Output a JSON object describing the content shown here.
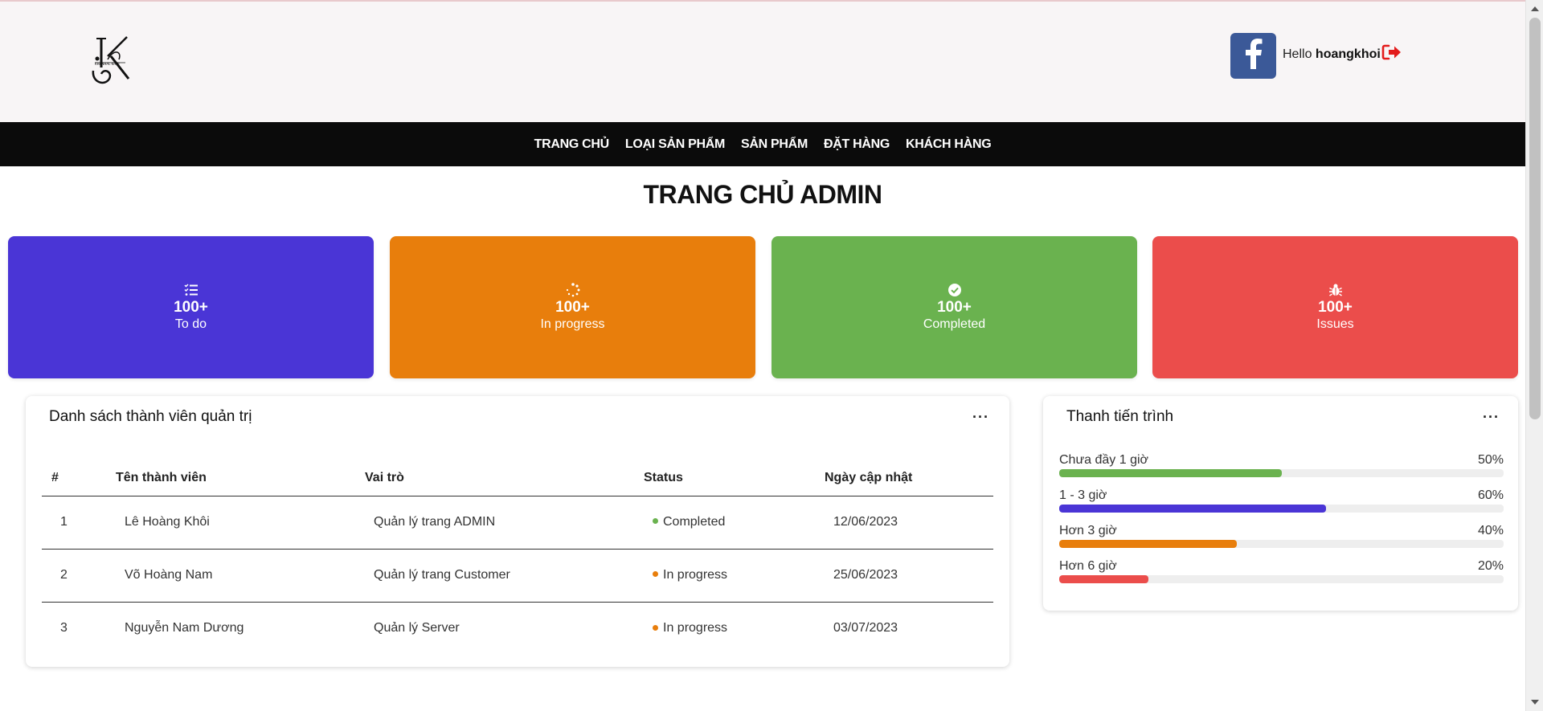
{
  "header": {
    "logo_icon": "kv-monogram-logo",
    "facebook_icon": "facebook-icon",
    "hello_prefix": "Hello",
    "username": "hoangkhoi",
    "logout_icon": "sign-out-icon",
    "logout_color": "#e31b1b"
  },
  "nav": {
    "items": [
      "TRANG CHỦ",
      "LOẠI SẢN PHẨM",
      "SẢN PHẨM",
      "ĐẶT HÀNG",
      "KHÁCH HÀNG"
    ]
  },
  "page_title": "TRANG CHỦ ADMIN",
  "stats": [
    {
      "icon": "task-list-icon",
      "value": "100+",
      "label": "To do",
      "color": "#4a35d6"
    },
    {
      "icon": "spinner-icon",
      "value": "100+",
      "label": "In progress",
      "color": "#e87e0c"
    },
    {
      "icon": "check-circle-icon",
      "value": "100+",
      "label": "Completed",
      "color": "#6ab24f"
    },
    {
      "icon": "bug-icon",
      "value": "100+",
      "label": "Issues",
      "color": "#eb4d4b"
    }
  ],
  "members_panel": {
    "title": "Danh sách thành viên quản trị",
    "menu_icon": "more-horizontal-icon",
    "columns": [
      "#",
      "Tên thành viên",
      "Vai trò",
      "Status",
      "Ngày cập nhật"
    ],
    "rows": [
      {
        "no": "1",
        "name": "Lê Hoàng Khôi",
        "role": "Quản lý trang ADMIN",
        "status": "Completed",
        "status_color": "#6ab24f",
        "date": "12/06/2023"
      },
      {
        "no": "2",
        "name": "Võ Hoàng Nam",
        "role": "Quản lý trang Customer",
        "status": "In progress",
        "status_color": "#e87e0c",
        "date": "25/06/2023"
      },
      {
        "no": "3",
        "name": "Nguyễn Nam Dương",
        "role": "Quản lý Server",
        "status": "In progress",
        "status_color": "#e87e0c",
        "date": "03/07/2023"
      }
    ]
  },
  "progress_panel": {
    "title": "Thanh tiến trình",
    "menu_icon": "more-horizontal-icon",
    "bars": [
      {
        "label": "Chưa đầy 1 giờ",
        "pct_text": "50%",
        "value": 0.5,
        "color": "#6ab24f"
      },
      {
        "label": "1 - 3 giờ",
        "pct_text": "60%",
        "value": 0.6,
        "color": "#4a35d6"
      },
      {
        "label": "Hơn 3 giờ",
        "pct_text": "40%",
        "value": 0.4,
        "color": "#e87e0c"
      },
      {
        "label": "Hơn 6 giờ",
        "pct_text": "20%",
        "value": 0.2,
        "color": "#eb4d4b"
      }
    ]
  }
}
